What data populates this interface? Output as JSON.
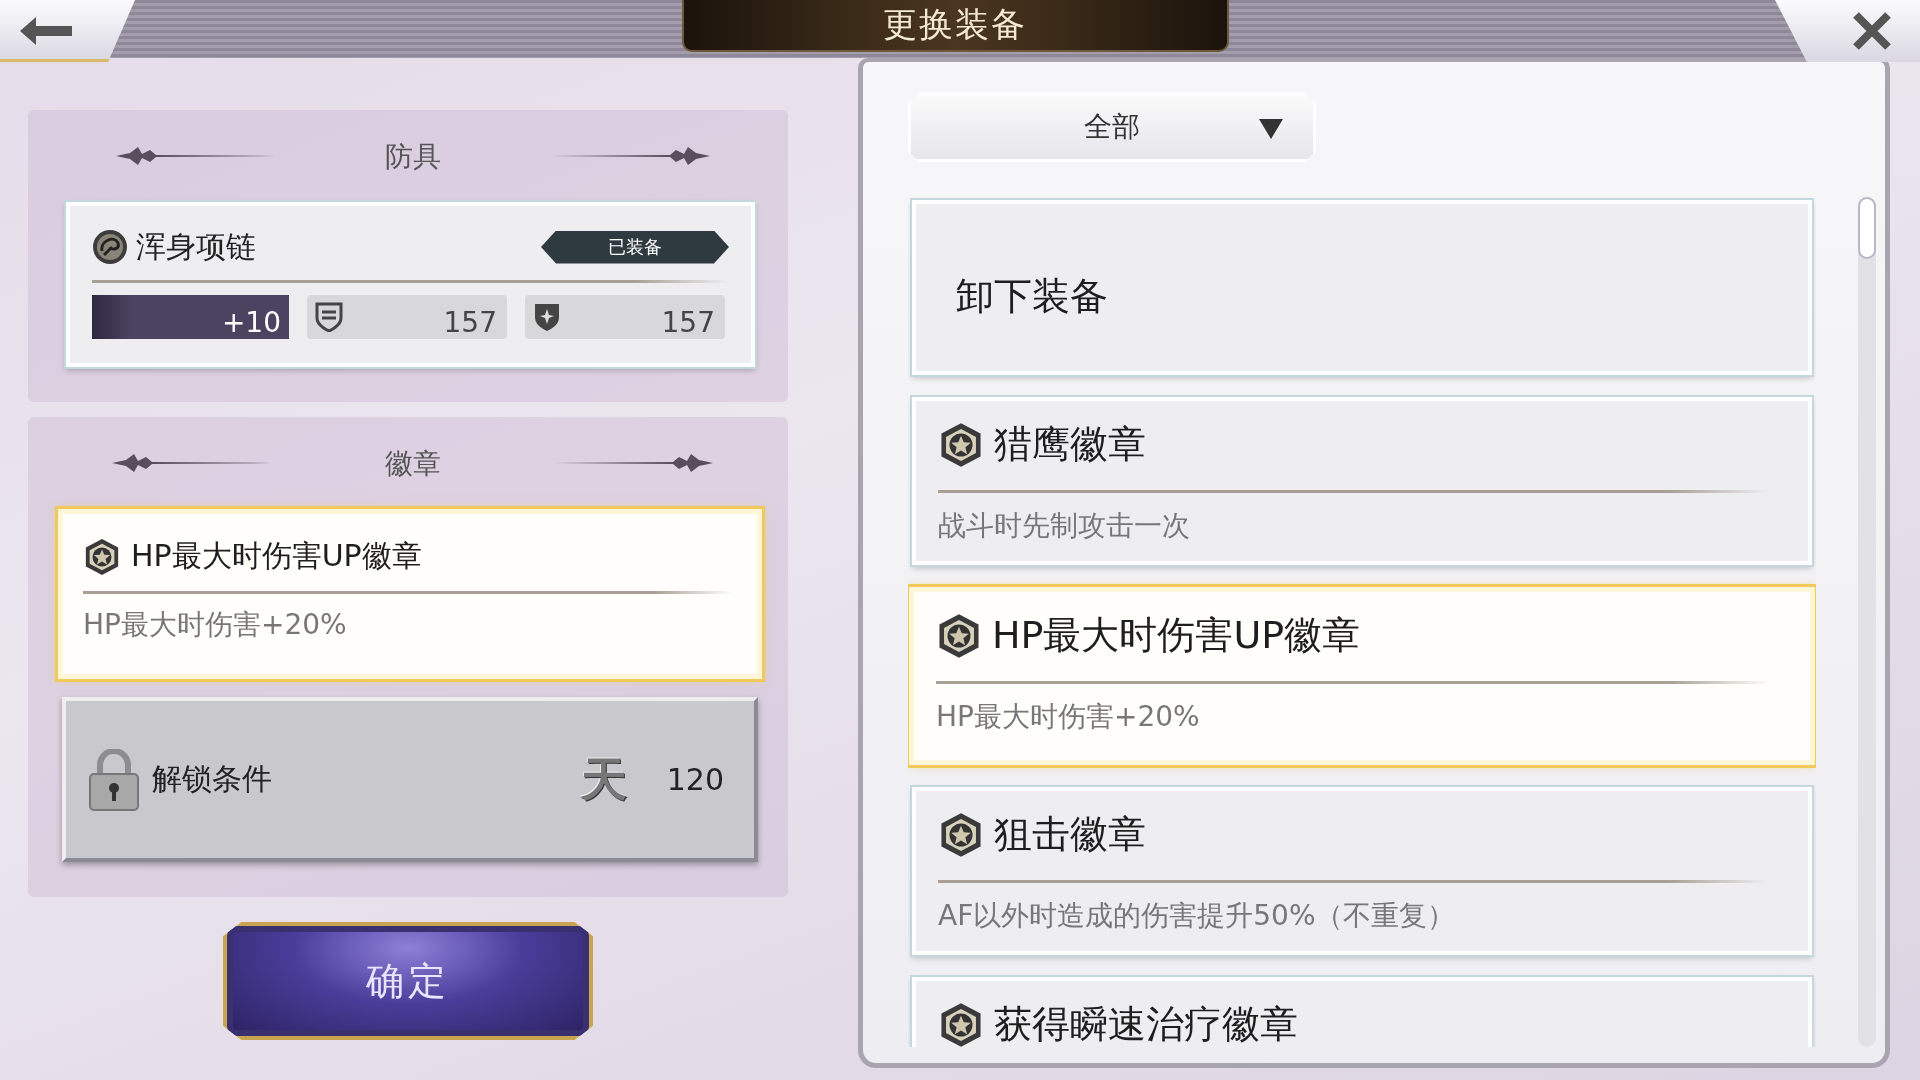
{
  "window": {
    "title": "更换装备"
  },
  "armor_section": {
    "heading": "防具",
    "item": {
      "name": "浑身项链",
      "status_badge": "已装备",
      "enhance": "+10",
      "stat_1": "157",
      "stat_2": "157"
    }
  },
  "badge_section": {
    "heading": "徽章",
    "slot": {
      "name": "HP最大时伤害UP徽章",
      "description": "HP最大时伤害+20%",
      "selected": true
    },
    "locked_slot": {
      "label": "解锁条件",
      "symbol": "天",
      "requirement": "120"
    }
  },
  "confirm_button": "确定",
  "filter": {
    "value": "全部"
  },
  "equipment_list": [
    {
      "kind": "action",
      "label": "卸下装备",
      "selected": false
    },
    {
      "kind": "badge",
      "name": "猎鹰徽章",
      "description": "战斗时先制攻击一次",
      "selected": false
    },
    {
      "kind": "badge",
      "name": "HP最大时伤害UP徽章",
      "description": "HP最大时伤害+20%",
      "selected": true
    },
    {
      "kind": "badge",
      "name": "狙击徽章",
      "description": "AF以外时造成的伤害提升50%（不重复）",
      "selected": false
    },
    {
      "kind": "badge",
      "name": "获得瞬速治疗徽章",
      "selected": false
    }
  ]
}
